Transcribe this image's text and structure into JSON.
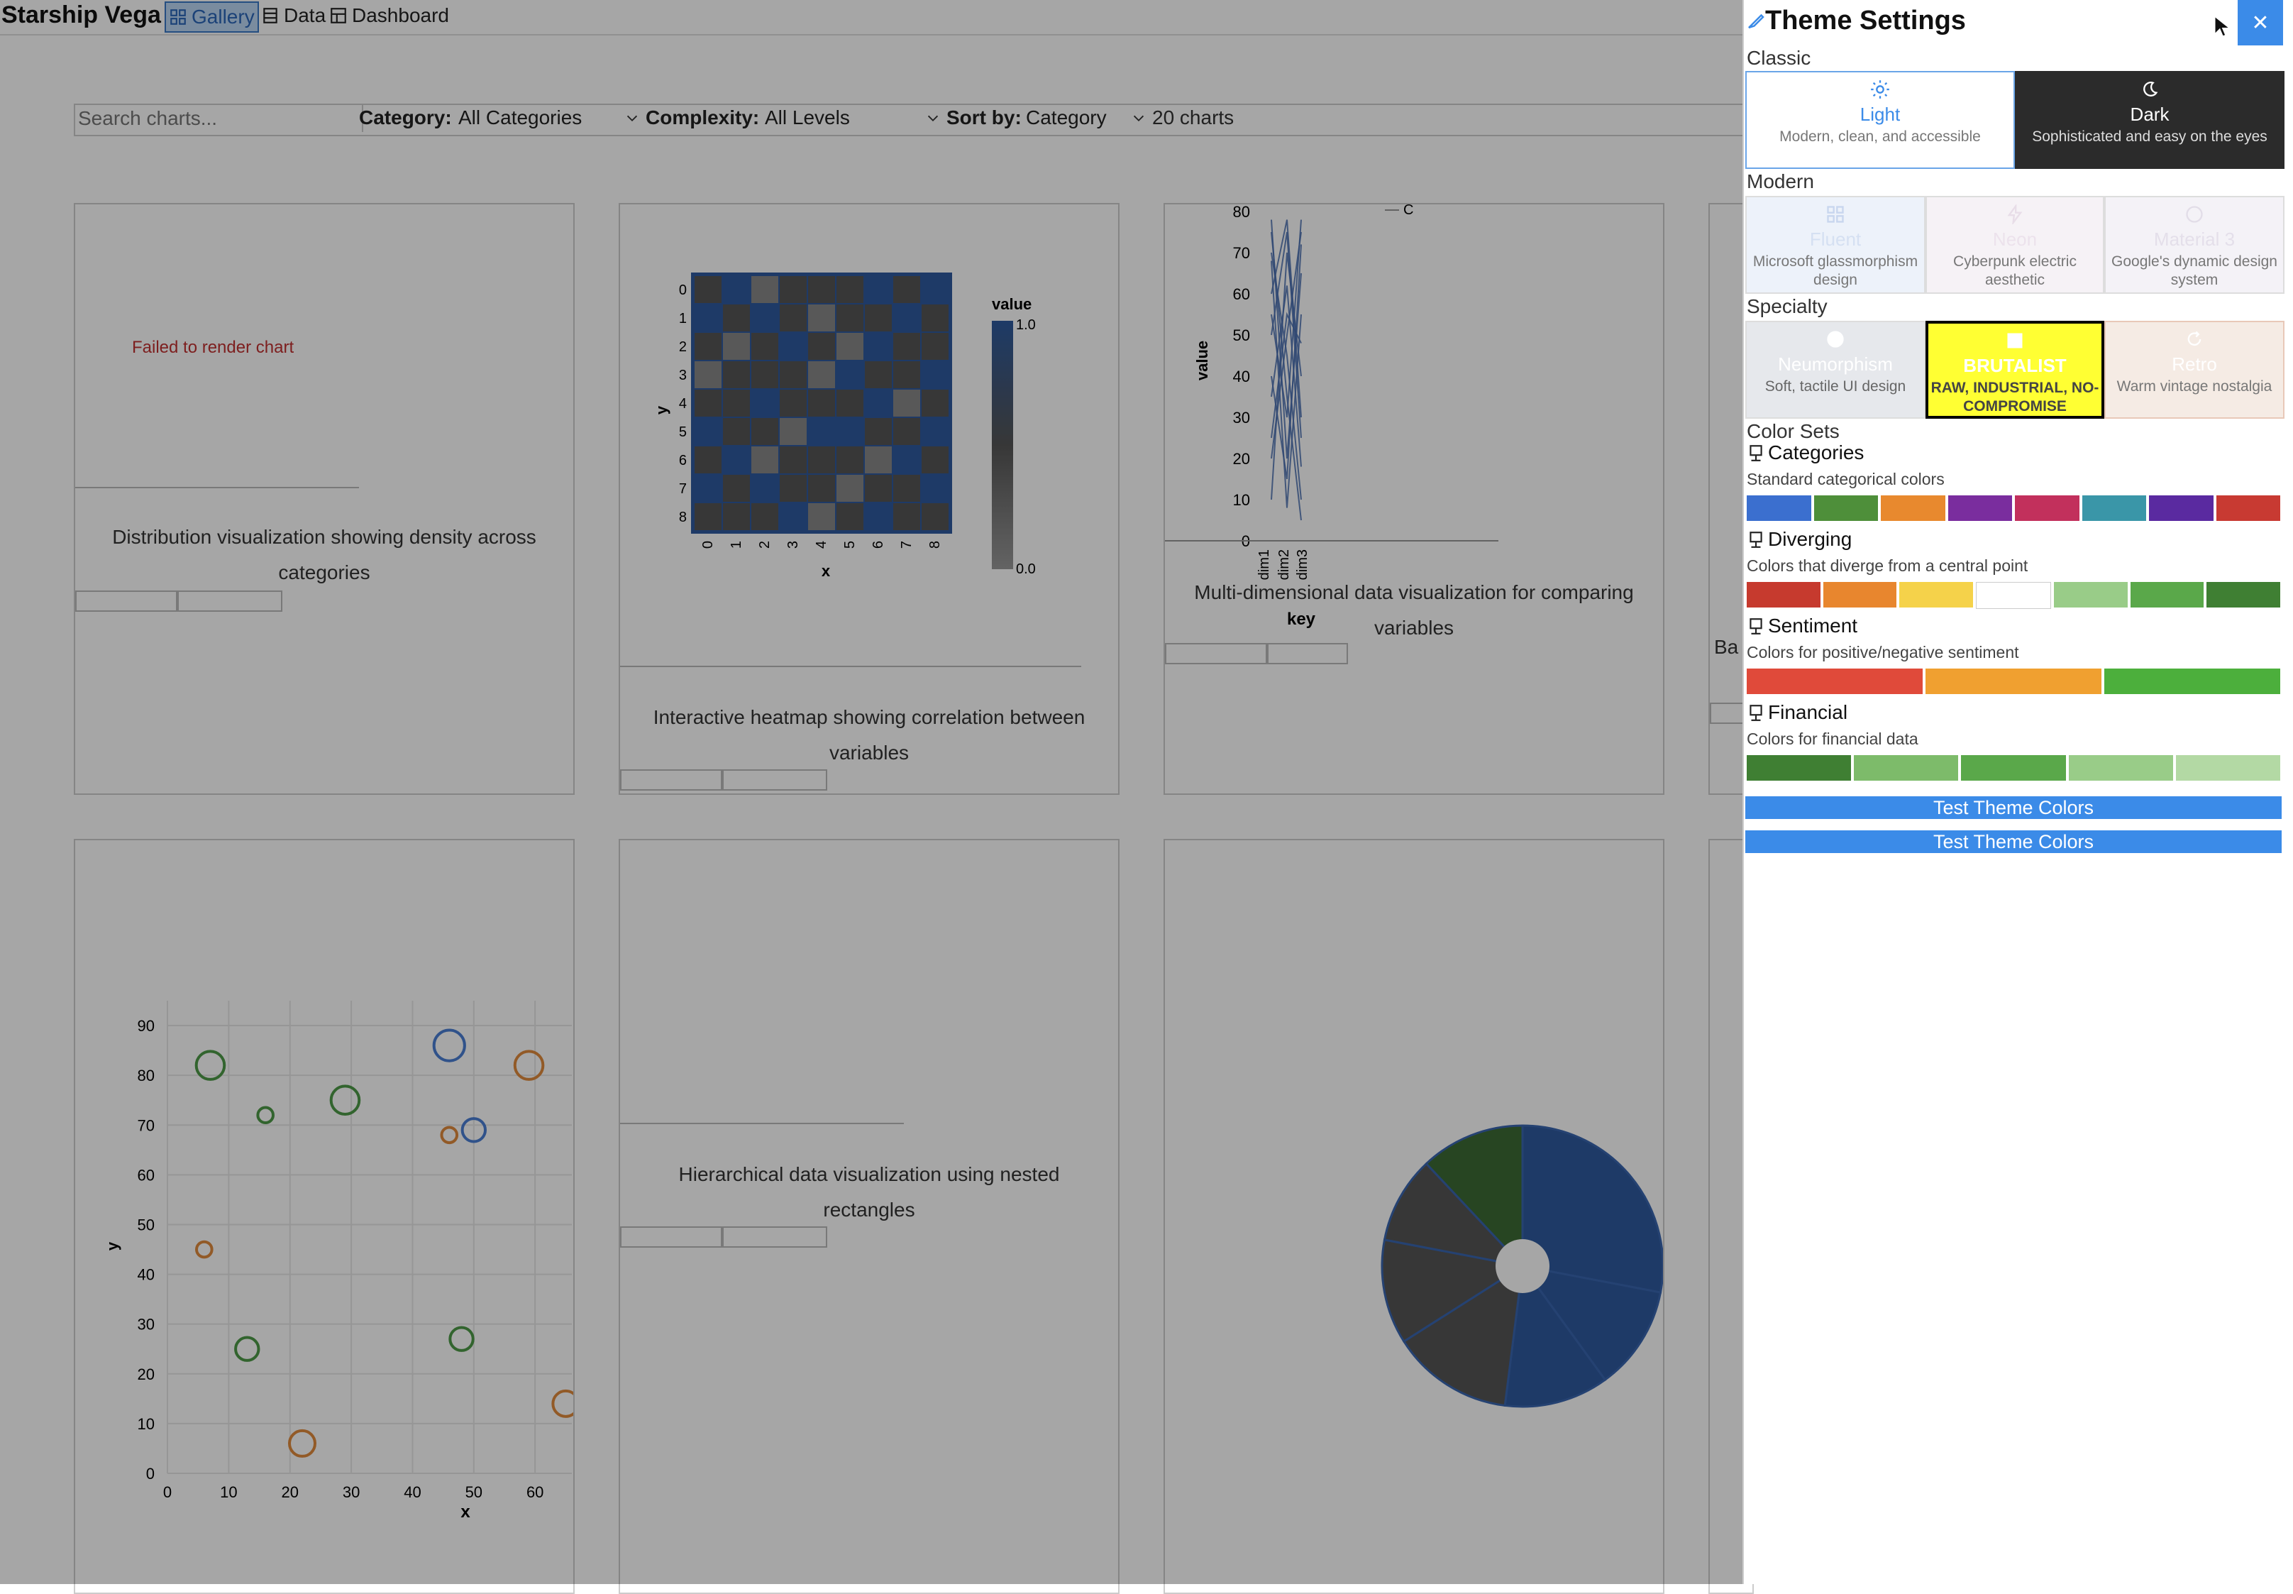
{
  "app": {
    "title": "Starship Vega",
    "nav": [
      {
        "label": "Gallery",
        "icon": "grid-icon",
        "active": true
      },
      {
        "label": "Data",
        "icon": "table-icon",
        "active": false
      },
      {
        "label": "Dashboard",
        "icon": "dashboard-icon",
        "active": false
      }
    ]
  },
  "filters": {
    "search_placeholder": "Search charts...",
    "category_label": "Category:",
    "category_value": "All Categories",
    "complexity_label": "Complexity:",
    "complexity_value": "All Levels",
    "sort_label": "Sort by:",
    "sort_value": "Category",
    "count": "20 charts"
  },
  "cards": [
    {
      "id": "distribution",
      "error": "Failed to render chart",
      "description": "Distribution visualization showing density across categories"
    },
    {
      "id": "heatmap",
      "description": "Interactive heatmap showing correlation between variables",
      "chart": {
        "xlabel": "x",
        "ylabel": "y",
        "legend_title": "value",
        "legend_max": "1.0",
        "legend_min": "0.0",
        "ticks": [
          "0",
          "1",
          "2",
          "3",
          "4",
          "5",
          "6",
          "7",
          "8"
        ]
      }
    },
    {
      "id": "parallel",
      "description": "Multi-dimensional data visualization for comparing variables",
      "chart": {
        "ylabel": "value",
        "xlabel": "key",
        "y_ticks": [
          "80",
          "70",
          "60",
          "50",
          "40",
          "30",
          "20",
          "10",
          "0"
        ],
        "x_ticks": [
          "dim1",
          "dim2",
          "dim3"
        ],
        "legend_c": "C"
      }
    },
    {
      "id": "partial",
      "description_fragment": "Ba"
    },
    {
      "id": "scatter",
      "chart": {
        "xlabel": "x",
        "ylabel": "y",
        "x_ticks": [
          "0",
          "10",
          "20",
          "30",
          "40",
          "50",
          "60"
        ],
        "y_ticks": [
          "90",
          "80",
          "70",
          "60",
          "50",
          "40",
          "30",
          "20",
          "10",
          "0"
        ]
      }
    },
    {
      "id": "treemap",
      "description": "Hierarchical data visualization using nested rectangles"
    },
    {
      "id": "donut"
    }
  ],
  "chart_data": [
    {
      "type": "heatmap",
      "x": [
        0,
        1,
        2,
        3,
        4,
        5,
        6,
        7,
        8
      ],
      "y": [
        0,
        1,
        2,
        3,
        4,
        5,
        6,
        7,
        8
      ],
      "colorscale_range": [
        0,
        1
      ],
      "values": [
        [
          0.5,
          1,
          0.2,
          0.5,
          0.5,
          0.5,
          1,
          0.5,
          1
        ],
        [
          1,
          0.5,
          1,
          0.5,
          0.2,
          0.5,
          0.5,
          1,
          0.5
        ],
        [
          0.5,
          0.2,
          0.5,
          1,
          0.5,
          0.2,
          1,
          0.5,
          0.5
        ],
        [
          0.2,
          0.5,
          0.5,
          0.5,
          0.2,
          1,
          0.5,
          0.5,
          1
        ],
        [
          0.5,
          0.5,
          1,
          0.5,
          0.5,
          0.5,
          1,
          0.2,
          0.5
        ],
        [
          1,
          0.5,
          0.5,
          0.2,
          1,
          1,
          0.5,
          0.5,
          1
        ],
        [
          0.5,
          1,
          0.2,
          0.5,
          0.5,
          0.5,
          0.2,
          1,
          0.5
        ],
        [
          1,
          0.5,
          1,
          0.5,
          0.5,
          0.2,
          0.5,
          0.5,
          1
        ],
        [
          0.5,
          0.5,
          0.5,
          1,
          0.2,
          0.5,
          1,
          0.5,
          0.5
        ]
      ]
    },
    {
      "type": "line",
      "x": [
        "dim1",
        "dim2",
        "dim3"
      ],
      "ylim": [
        0,
        80
      ],
      "series": [
        {
          "values": [
            78,
            20,
            65
          ]
        },
        {
          "values": [
            70,
            45,
            10
          ]
        },
        {
          "values": [
            60,
            78,
            30
          ]
        },
        {
          "values": [
            40,
            15,
            72
          ]
        },
        {
          "values": [
            25,
            55,
            48
          ]
        },
        {
          "values": [
            75,
            35,
            5
          ]
        },
        {
          "values": [
            10,
            70,
            40
          ]
        },
        {
          "values": [
            55,
            30,
            78
          ]
        },
        {
          "values": [
            35,
            62,
            18
          ]
        },
        {
          "values": [
            68,
            8,
            55
          ]
        },
        {
          "values": [
            20,
            50,
            75
          ]
        },
        {
          "values": [
            50,
            75,
            25
          ]
        }
      ]
    },
    {
      "type": "scatter",
      "xlim": [
        0,
        66
      ],
      "ylim": [
        0,
        95
      ],
      "series": [
        {
          "color": "#4a7fd4",
          "points": [
            {
              "x": 46,
              "y": 86,
              "s": 12
            },
            {
              "x": 50,
              "y": 69,
              "s": 9
            }
          ]
        },
        {
          "color": "#e08a3c",
          "points": [
            {
              "x": 59,
              "y": 82,
              "s": 11
            },
            {
              "x": 46,
              "y": 68,
              "s": 6
            },
            {
              "x": 6,
              "y": 45,
              "s": 6
            },
            {
              "x": 22,
              "y": 6,
              "s": 10
            },
            {
              "x": 65,
              "y": 14,
              "s": 10
            }
          ]
        },
        {
          "color": "#4e9a47",
          "points": [
            {
              "x": 7,
              "y": 82,
              "s": 11
            },
            {
              "x": 16,
              "y": 72,
              "s": 6
            },
            {
              "x": 29,
              "y": 75,
              "s": 11
            },
            {
              "x": 13,
              "y": 25,
              "s": 9
            },
            {
              "x": 48,
              "y": 27,
              "s": 9
            }
          ]
        }
      ]
    },
    {
      "type": "pie",
      "values": [
        28,
        12,
        12,
        14,
        12,
        10,
        12
      ],
      "colors": [
        "#2e5a9e",
        "#2e5a9e",
        "#2e5a9e",
        "#555555",
        "#555555",
        "#555555",
        "#3d6a35"
      ]
    }
  ],
  "theme_panel": {
    "title": "Theme Settings",
    "close_label": "✕",
    "sections": {
      "classic": "Classic",
      "modern": "Modern",
      "specialty": "Specialty",
      "color_sets": "Color Sets"
    },
    "classic": [
      {
        "name": "Light",
        "desc": "Modern, clean, and accessible"
      },
      {
        "name": "Dark",
        "desc": "Sophisticated and easy on the eyes"
      }
    ],
    "modern": [
      {
        "name": "Fluent",
        "desc": "Microsoft glassmorphism design"
      },
      {
        "name": "Neon",
        "desc": "Cyberpunk electric aesthetic"
      },
      {
        "name": "Material 3",
        "desc": "Google's dynamic design system"
      }
    ],
    "specialty": [
      {
        "name": "Neumorphism",
        "desc": "Soft, tactile UI design"
      },
      {
        "name": "BRUTALIST",
        "desc": "RAW, INDUSTRIAL, NO-COMPROMISE"
      },
      {
        "name": "Retro",
        "desc": "Warm vintage nostalgia"
      }
    ],
    "color_sets": [
      {
        "name": "Categories",
        "desc": "Standard categorical colors",
        "colors": [
          "#3b6fcf",
          "#4e8f3a",
          "#e8892e",
          "#7a2d9e",
          "#c2305c",
          "#3a96a8",
          "#5a2aa0",
          "#c83a32"
        ]
      },
      {
        "name": "Diverging",
        "desc": "Colors that diverge from a central point",
        "colors": [
          "#c63a2e",
          "#e8862e",
          "#f5d24a",
          "#ffffff",
          "#99cc88",
          "#5aa84a",
          "#3f7f33"
        ]
      },
      {
        "name": "Sentiment",
        "desc": "Colors for positive/negative sentiment",
        "colors": [
          "#e04a3a",
          "#f0a030",
          "#4caf3c"
        ]
      },
      {
        "name": "Financial",
        "desc": "Colors for financial data",
        "colors": [
          "#3f7f33",
          "#7dbb6a",
          "#5aa84a",
          "#99cc88",
          "#b3d9a4"
        ]
      }
    ],
    "test_buttons": [
      "Test Theme Colors",
      "Test Theme Colors"
    ]
  }
}
